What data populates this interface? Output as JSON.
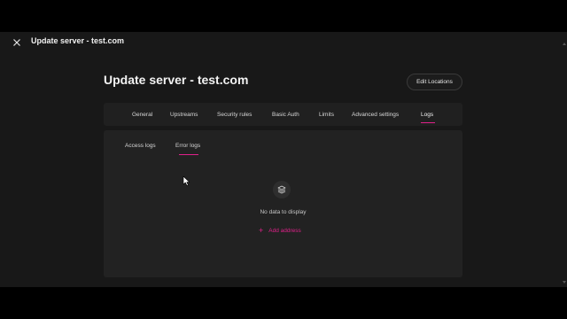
{
  "window": {
    "title": "Update server - test.com"
  },
  "header": {
    "title": "Update server - test.com",
    "edit_locations_label": "Edit Locations"
  },
  "tabs": [
    {
      "label": "General"
    },
    {
      "label": "Upstreams"
    },
    {
      "label": "Security rules"
    },
    {
      "label": "Basic Auth"
    },
    {
      "label": "Limits"
    },
    {
      "label": "Advanced settings"
    },
    {
      "label": "Logs"
    }
  ],
  "active_tab": "Logs",
  "subtabs": [
    {
      "label": "Access logs"
    },
    {
      "label": "Error logs"
    }
  ],
  "active_subtab": "Error logs",
  "empty_state": {
    "icon": "layers-icon",
    "message": "No data to display",
    "add_label": "Add address",
    "add_icon": "plus-icon"
  },
  "colors": {
    "accent": "#e0218a",
    "background": "#181818",
    "panel": "#222222"
  }
}
